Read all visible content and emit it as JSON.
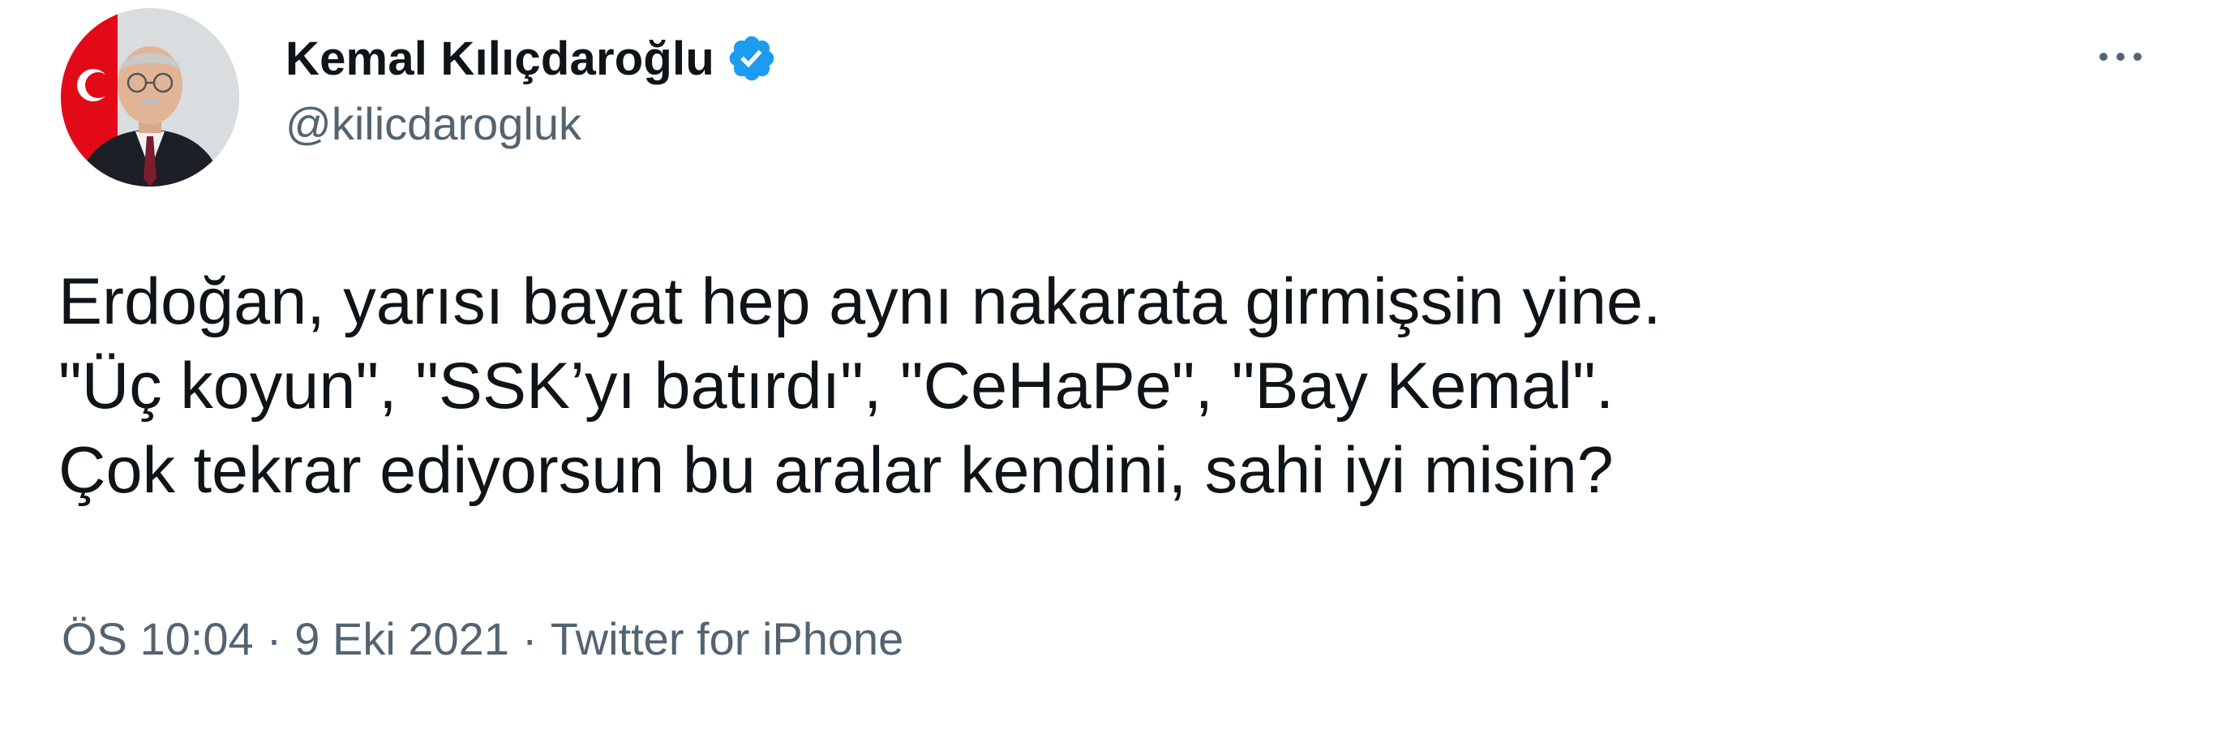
{
  "user": {
    "display_name": "Kemal Kılıçdaroğlu",
    "handle": "@kilicdarogluk",
    "verified": true,
    "avatar_icon": "profile-photo"
  },
  "tweet": {
    "lines": [
      "Erdoğan, yarısı bayat hep aynı nakarata girmişsin yine.",
      "\"Üç koyun\", \"SSK’yı batırdı\", \"CeHaPe\", \"Bay Kemal\".",
      "Çok tekrar ediyorsun bu aralar kendini, sahi iyi misin?"
    ]
  },
  "meta": {
    "time": "ÖS 10:04",
    "separator": "·",
    "date": "9 Eki 2021",
    "source": "Twitter for iPhone"
  },
  "icons": {
    "verified": "verified-badge-icon",
    "more": "more-horizontal-icon"
  },
  "colors": {
    "accent": "#1d9bf0",
    "text_primary": "#0f1419",
    "text_secondary": "#536471"
  }
}
